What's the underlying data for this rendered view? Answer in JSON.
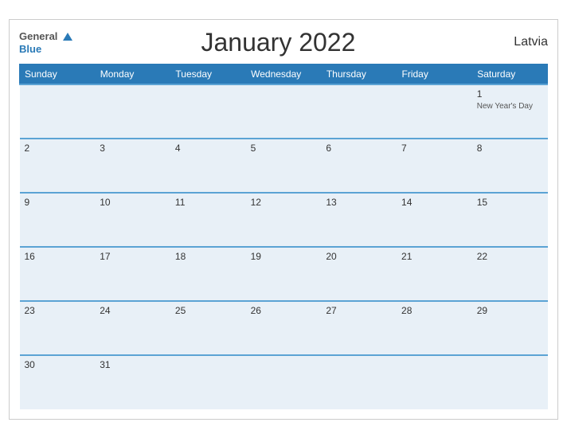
{
  "header": {
    "logo_general": "General",
    "logo_blue": "Blue",
    "title": "January 2022",
    "country": "Latvia"
  },
  "days_of_week": [
    "Sunday",
    "Monday",
    "Tuesday",
    "Wednesday",
    "Thursday",
    "Friday",
    "Saturday"
  ],
  "weeks": [
    [
      {
        "day": "",
        "holiday": ""
      },
      {
        "day": "",
        "holiday": ""
      },
      {
        "day": "",
        "holiday": ""
      },
      {
        "day": "",
        "holiday": ""
      },
      {
        "day": "",
        "holiday": ""
      },
      {
        "day": "",
        "holiday": ""
      },
      {
        "day": "1",
        "holiday": "New Year's Day"
      }
    ],
    [
      {
        "day": "2",
        "holiday": ""
      },
      {
        "day": "3",
        "holiday": ""
      },
      {
        "day": "4",
        "holiday": ""
      },
      {
        "day": "5",
        "holiday": ""
      },
      {
        "day": "6",
        "holiday": ""
      },
      {
        "day": "7",
        "holiday": ""
      },
      {
        "day": "8",
        "holiday": ""
      }
    ],
    [
      {
        "day": "9",
        "holiday": ""
      },
      {
        "day": "10",
        "holiday": ""
      },
      {
        "day": "11",
        "holiday": ""
      },
      {
        "day": "12",
        "holiday": ""
      },
      {
        "day": "13",
        "holiday": ""
      },
      {
        "day": "14",
        "holiday": ""
      },
      {
        "day": "15",
        "holiday": ""
      }
    ],
    [
      {
        "day": "16",
        "holiday": ""
      },
      {
        "day": "17",
        "holiday": ""
      },
      {
        "day": "18",
        "holiday": ""
      },
      {
        "day": "19",
        "holiday": ""
      },
      {
        "day": "20",
        "holiday": ""
      },
      {
        "day": "21",
        "holiday": ""
      },
      {
        "day": "22",
        "holiday": ""
      }
    ],
    [
      {
        "day": "23",
        "holiday": ""
      },
      {
        "day": "24",
        "holiday": ""
      },
      {
        "day": "25",
        "holiday": ""
      },
      {
        "day": "26",
        "holiday": ""
      },
      {
        "day": "27",
        "holiday": ""
      },
      {
        "day": "28",
        "holiday": ""
      },
      {
        "day": "29",
        "holiday": ""
      }
    ],
    [
      {
        "day": "30",
        "holiday": ""
      },
      {
        "day": "31",
        "holiday": ""
      },
      {
        "day": "",
        "holiday": ""
      },
      {
        "day": "",
        "holiday": ""
      },
      {
        "day": "",
        "holiday": ""
      },
      {
        "day": "",
        "holiday": ""
      },
      {
        "day": "",
        "holiday": ""
      }
    ]
  ],
  "colors": {
    "header_bg": "#2a7ab7",
    "cell_bg": "#e8f0f7",
    "border_accent": "#5ba3d4"
  }
}
